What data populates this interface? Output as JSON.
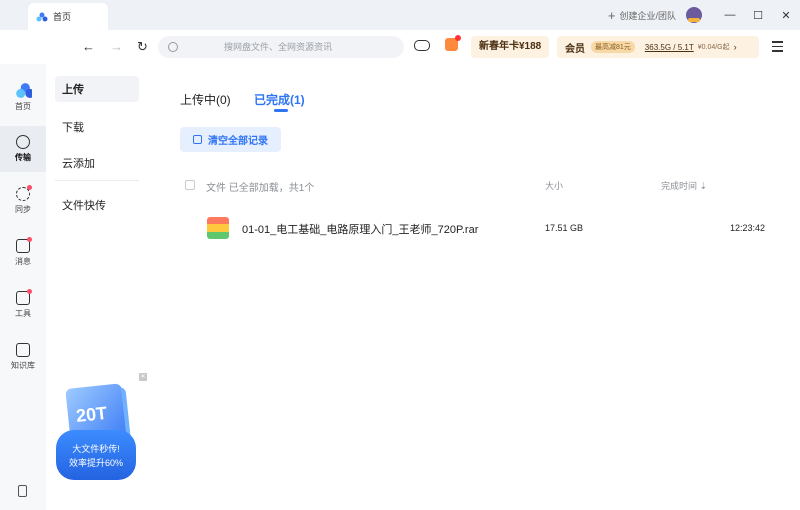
{
  "titlebar": {
    "tab_label": "首页",
    "create_enterprise": "创建企业/团队",
    "window_controls": [
      "minimize",
      "maximize",
      "close"
    ]
  },
  "toolbar": {
    "search_placeholder": "搜网盘文件、全网资源资讯",
    "promo_label": "新春年卡¥188",
    "member_label": "会员",
    "member_badge": "最高减81元",
    "storage": "363.5G / 5.1T",
    "price": "¥0.04/G起"
  },
  "leftnav": {
    "items": [
      {
        "label": "首页",
        "icon": "home-icon"
      },
      {
        "label": "传输",
        "icon": "transfer-icon"
      },
      {
        "label": "同步",
        "icon": "sync-icon"
      },
      {
        "label": "消息",
        "icon": "message-icon"
      },
      {
        "label": "工具",
        "icon": "tools-icon"
      },
      {
        "label": "知识库",
        "icon": "knowledge-icon"
      }
    ]
  },
  "sidebar": {
    "items": [
      "上传",
      "下载",
      "云添加",
      "文件快传"
    ],
    "ad_title": "20T",
    "ad_line1": "大文件秒传!",
    "ad_line2": "效率提升60%"
  },
  "main": {
    "tab_uploading": "上传中(0)",
    "tab_done": "已完成(1)",
    "clear_btn": "清空全部记录",
    "header_file": "文件 已全部加载，共1个",
    "header_size": "大小",
    "header_time": "完成时间",
    "rows": [
      {
        "name": "01-01_电工基础_电路原理入门_王老师_720P.rar",
        "size": "17.51 GB",
        "time": "12:23:42"
      }
    ]
  },
  "colors": {
    "accent": "#2f74f5",
    "promo_bg": "#fdf1e1"
  }
}
